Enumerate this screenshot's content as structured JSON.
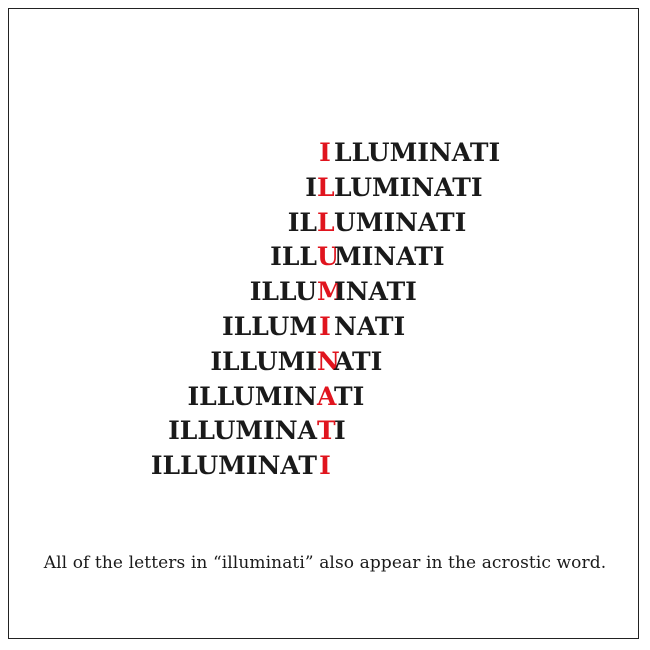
{
  "colors": {
    "text": "#1a1a1a",
    "highlight": "#e0141e",
    "border": "#222222",
    "background": "#ffffff"
  },
  "acrostic": {
    "rows": [
      {
        "before": "",
        "letter": "I",
        "after": "LLUMINATI"
      },
      {
        "before": "I",
        "letter": "L",
        "after": "LUMINATI"
      },
      {
        "before": "IL",
        "letter": "L",
        "after": "UMINATI"
      },
      {
        "before": "ILL",
        "letter": "U",
        "after": "MINATI"
      },
      {
        "before": "ILLU",
        "letter": "M",
        "after": "INATI"
      },
      {
        "before": "ILLUM",
        "letter": "I",
        "after": "NATI"
      },
      {
        "before": "ILLUMI",
        "letter": "N",
        "after": "ATI"
      },
      {
        "before": "ILLUMIN",
        "letter": "A",
        "after": "TI"
      },
      {
        "before": "ILLUMINA",
        "letter": "T",
        "after": "I"
      },
      {
        "before": "ILLUMINAT",
        "letter": "I",
        "after": ""
      }
    ]
  },
  "caption": "All of the letters in “illuminati” also appear in the acrostic word."
}
